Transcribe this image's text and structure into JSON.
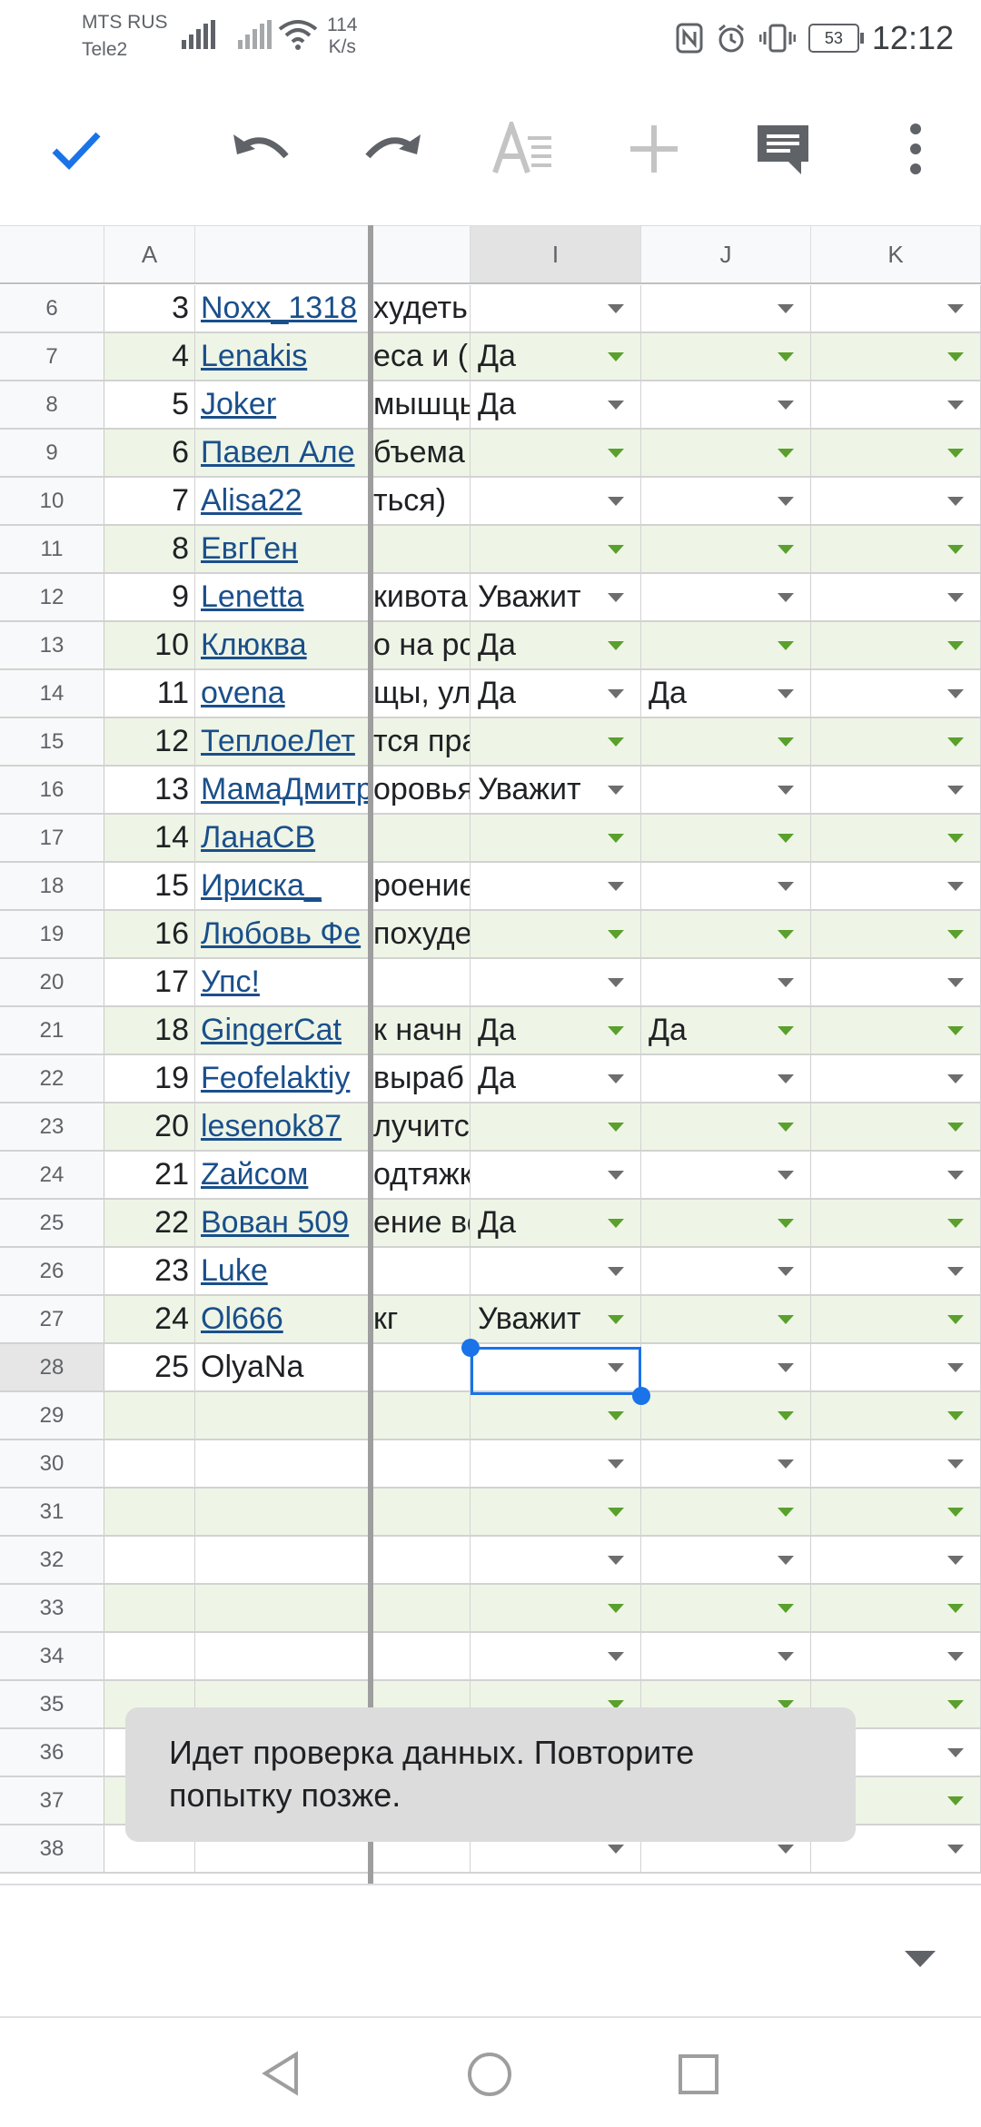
{
  "status_bar": {
    "carrier1": "MTS RUS",
    "carrier2": "Tele2",
    "speed_value": "114",
    "speed_unit": "K/s",
    "battery": "53",
    "time": "12:12"
  },
  "toolbar": {
    "icons": [
      "check-icon",
      "undo-icon",
      "redo-icon",
      "text-format-icon",
      "add-icon",
      "comment-icon",
      "more-vert-icon"
    ]
  },
  "columns": {
    "a": "A",
    "i": "I",
    "j": "J",
    "k": "K"
  },
  "rows": [
    {
      "n": "6",
      "a": "3",
      "b": "Noxx_1318",
      "link": true,
      "h": "худеть",
      "i": "",
      "j": ""
    },
    {
      "n": "7",
      "a": "4",
      "b": "Lenakis",
      "link": true,
      "h": "еса и (",
      "i": "Да",
      "j": ""
    },
    {
      "n": "8",
      "a": "5",
      "b": "Joker",
      "link": true,
      "h": "мышцы",
      "i": "Да",
      "j": ""
    },
    {
      "n": "9",
      "a": "6",
      "b": "Павел Але",
      "link": true,
      "h": "бъема",
      "i": "",
      "j": ""
    },
    {
      "n": "10",
      "a": "7",
      "b": "Alisa22",
      "link": true,
      "h": "ться)",
      "i": "",
      "j": ""
    },
    {
      "n": "11",
      "a": "8",
      "b": "ЕвгГен",
      "link": true,
      "h": "",
      "i": "",
      "j": ""
    },
    {
      "n": "12",
      "a": "9",
      "b": "Lenetta",
      "link": true,
      "h": "кивота",
      "i": "Уважит",
      "j": ""
    },
    {
      "n": "13",
      "a": "10",
      "b": "Клюква",
      "link": true,
      "h": "о на рс",
      "i": "Да",
      "j": ""
    },
    {
      "n": "14",
      "a": "11",
      "b": "ovena",
      "link": true,
      "h": "щы, ул",
      "i": "Да",
      "j": "Да"
    },
    {
      "n": "15",
      "a": "12",
      "b": "ТеплоеЛет",
      "link": true,
      "h": "тся прав",
      "i": "",
      "j": ""
    },
    {
      "n": "16",
      "a": "13",
      "b": "МамаДмитр",
      "link": true,
      "h": "оровья",
      "i": "Уважит",
      "j": ""
    },
    {
      "n": "17",
      "a": "14",
      "b": "ЛанаСВ",
      "link": true,
      "h": "",
      "i": "",
      "j": ""
    },
    {
      "n": "18",
      "a": "15",
      "b": "Ириска_",
      "link": true,
      "h": "роение",
      "i": "",
      "j": ""
    },
    {
      "n": "19",
      "a": "16",
      "b": "Любовь Фе",
      "link": true,
      "h": "похуде",
      "i": "",
      "j": ""
    },
    {
      "n": "20",
      "a": "17",
      "b": "Упс!",
      "link": true,
      "h": "",
      "i": "",
      "j": ""
    },
    {
      "n": "21",
      "a": "18",
      "b": "GingerCat",
      "link": true,
      "h": "к начн",
      "i": "Да",
      "j": "Да"
    },
    {
      "n": "22",
      "a": "19",
      "b": "Feofelaktiy",
      "link": true,
      "h": "выраб",
      "i": "Да",
      "j": ""
    },
    {
      "n": "23",
      "a": "20",
      "b": "lesenok87",
      "link": true,
      "h": "лучитс",
      "i": "",
      "j": ""
    },
    {
      "n": "24",
      "a": "21",
      "b": "Zайсом",
      "link": true,
      "h": "одтяжк",
      "i": "",
      "j": ""
    },
    {
      "n": "25",
      "a": "22",
      "b": "Вован 509",
      "link": true,
      "h": "ение вс",
      "i": "Да",
      "j": ""
    },
    {
      "n": "26",
      "a": "23",
      "b": "Luke",
      "link": true,
      "h": "",
      "i": "",
      "j": ""
    },
    {
      "n": "27",
      "a": "24",
      "b": "Ol666",
      "link": true,
      "h": "кг",
      "i": "Уважит",
      "j": ""
    },
    {
      "n": "28",
      "a": "25",
      "b": "OlyaNa",
      "link": false,
      "h": "",
      "i": "",
      "j": ""
    },
    {
      "n": "29",
      "a": "",
      "b": "",
      "link": false,
      "h": "",
      "i": "",
      "j": ""
    },
    {
      "n": "30",
      "a": "",
      "b": "",
      "link": false,
      "h": "",
      "i": "",
      "j": ""
    },
    {
      "n": "31",
      "a": "",
      "b": "",
      "link": false,
      "h": "",
      "i": "",
      "j": ""
    },
    {
      "n": "32",
      "a": "",
      "b": "",
      "link": false,
      "h": "",
      "i": "",
      "j": ""
    },
    {
      "n": "33",
      "a": "",
      "b": "",
      "link": false,
      "h": "",
      "i": "",
      "j": ""
    },
    {
      "n": "34",
      "a": "",
      "b": "",
      "link": false,
      "h": "",
      "i": "",
      "j": ""
    },
    {
      "n": "35",
      "a": "",
      "b": "",
      "link": false,
      "h": "",
      "i": "",
      "j": ""
    },
    {
      "n": "36",
      "a": "",
      "b": "",
      "link": false,
      "h": "",
      "i": "",
      "j": ""
    },
    {
      "n": "37",
      "a": "",
      "b": "",
      "link": false,
      "h": "",
      "i": "",
      "j": ""
    },
    {
      "n": "38",
      "a": "",
      "b": "",
      "link": false,
      "h": "",
      "i": "",
      "j": ""
    }
  ],
  "selected_cell": "I28",
  "toast": {
    "message": "Идет проверка данных. Повторите попытку позже."
  },
  "colors": {
    "accent": "#1a73e8",
    "band": "#eef5e6",
    "link": "#1a4f8b",
    "dropdown_band": "#5aa02c"
  }
}
